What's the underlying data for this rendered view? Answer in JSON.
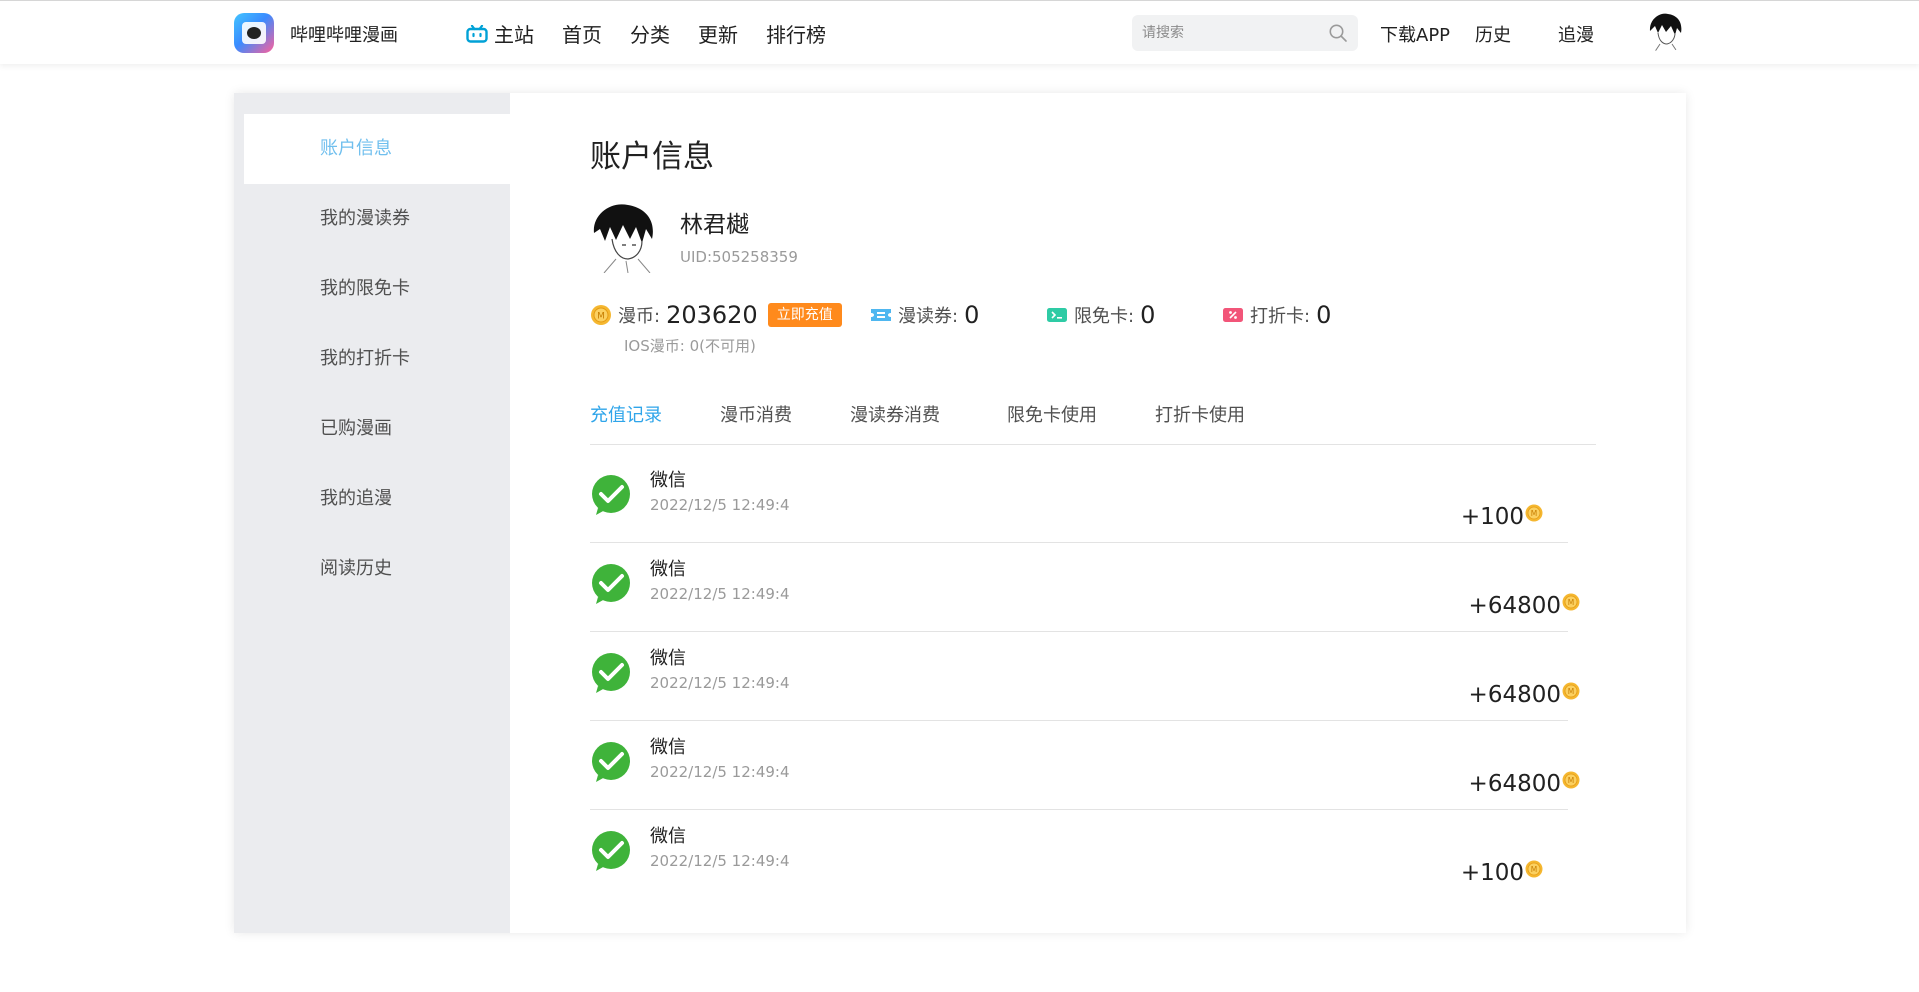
{
  "header": {
    "site_name": "哔哩哔哩漫画",
    "nav": [
      "主站",
      "首页",
      "分类",
      "更新",
      "排行榜"
    ],
    "search_placeholder": "请搜索",
    "links": [
      "下载APP",
      "历史",
      "追漫"
    ]
  },
  "sidebar": {
    "items": [
      "账户信息",
      "我的漫读券",
      "我的限免卡",
      "我的打折卡",
      "已购漫画",
      "我的追漫",
      "阅读历史"
    ],
    "active_index": 0
  },
  "account": {
    "title": "账户信息",
    "user_name": "林君樾",
    "uid": "UID:505258359",
    "stats": {
      "coin_label": "漫币:",
      "coin_value": "203620",
      "recharge_button": "立即充值",
      "ticket_label": "漫读券:",
      "ticket_value": "0",
      "free_card_label": "限免卡:",
      "free_card_value": "0",
      "discount_card_label": "打折卡:",
      "discount_card_value": "0",
      "ios_coin": "IOS漫币: 0(不可用)"
    }
  },
  "tabs": [
    "充值记录",
    "漫币消费",
    "漫读券消费",
    "限免卡使用",
    "打折卡使用"
  ],
  "active_tab": 0,
  "records": [
    {
      "title": "微信",
      "time": "2022/12/5 12:49:4",
      "amount": "+100"
    },
    {
      "title": "微信",
      "time": "2022/12/5 12:49:4",
      "amount": "+64800"
    },
    {
      "title": "微信",
      "time": "2022/12/5 12:49:4",
      "amount": "+64800"
    },
    {
      "title": "微信",
      "time": "2022/12/5 12:49:4",
      "amount": "+64800"
    },
    {
      "title": "微信",
      "time": "2022/12/5 12:49:4",
      "amount": "+100"
    }
  ],
  "colors": {
    "accent_blue": "#2fa5ea",
    "sidebar_active": "#70bfee",
    "recharge_orange": "#ff8a1c",
    "wechat_green": "#3fb33a",
    "coin_gold": "#f5b730"
  }
}
